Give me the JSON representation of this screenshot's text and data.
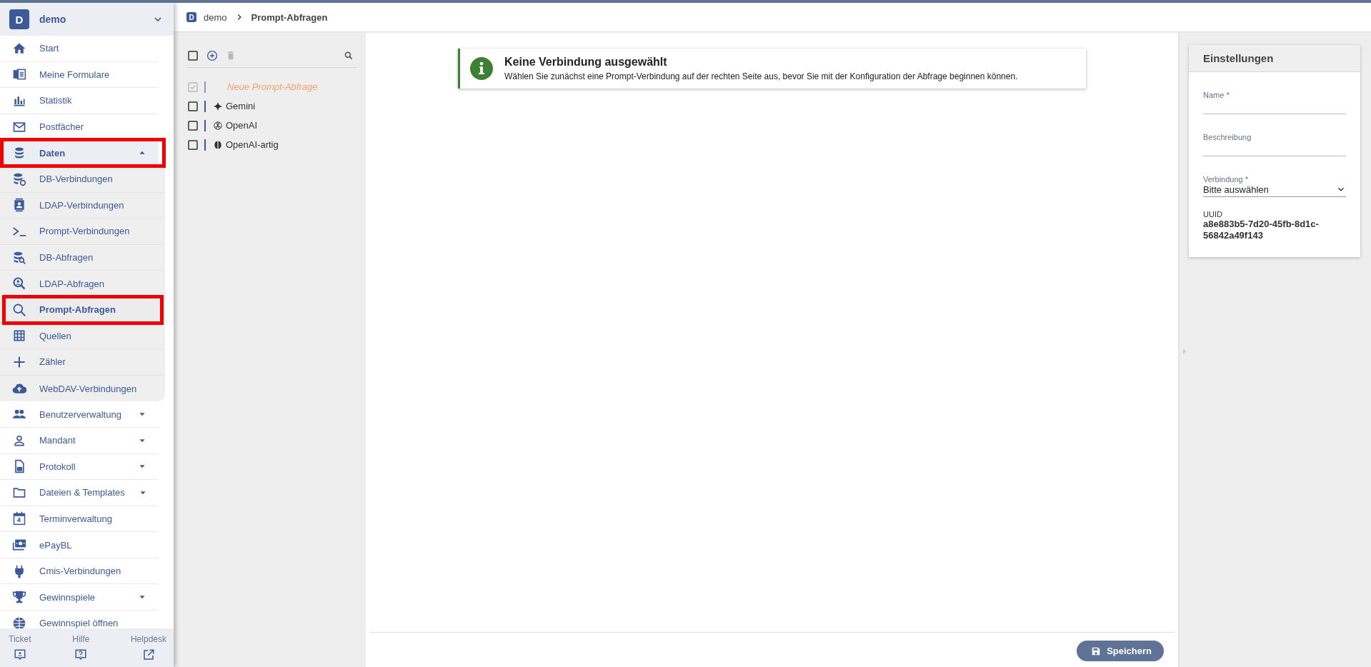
{
  "tenant": {
    "initial": "D",
    "name": "demo"
  },
  "nav": [
    {
      "label": "Start",
      "selected": false,
      "highlighted": false
    },
    {
      "label": "Meine Formulare",
      "selected": false,
      "highlighted": false
    },
    {
      "label": "Statistik",
      "selected": false,
      "highlighted": false
    },
    {
      "label": "Postfächer",
      "selected": false,
      "highlighted": false
    },
    {
      "label": "Daten",
      "selected": true,
      "highlighted": true,
      "expanded": true,
      "children": [
        {
          "label": "DB-Verbindungen",
          "selected": false,
          "highlighted": false
        },
        {
          "label": "LDAP-Verbindungen",
          "selected": false,
          "highlighted": false
        },
        {
          "label": "Prompt-Verbindungen",
          "selected": false,
          "highlighted": false
        },
        {
          "label": "DB-Abfragen",
          "selected": false,
          "highlighted": false
        },
        {
          "label": "LDAP-Abfragen",
          "selected": false,
          "highlighted": false
        },
        {
          "label": "Prompt-Abfragen",
          "selected": true,
          "highlighted": true
        },
        {
          "label": "Quellen",
          "selected": false,
          "highlighted": false
        },
        {
          "label": "Zähler",
          "selected": false,
          "highlighted": false
        },
        {
          "label": "WebDAV-Verbindungen",
          "selected": false,
          "highlighted": false
        }
      ]
    },
    {
      "label": "Benutzerverwaltung",
      "selected": false,
      "highlighted": false,
      "expanded": false
    },
    {
      "label": "Mandant",
      "selected": false,
      "highlighted": false,
      "expanded": false
    },
    {
      "label": "Protokoll",
      "selected": false,
      "highlighted": false,
      "expanded": false
    },
    {
      "label": "Dateien & Templates",
      "selected": false,
      "highlighted": false,
      "expanded": false
    },
    {
      "label": "Terminverwaltung",
      "selected": false,
      "highlighted": false
    },
    {
      "label": "ePayBL",
      "selected": false,
      "highlighted": false
    },
    {
      "label": "Cmis-Verbindungen",
      "selected": false,
      "highlighted": false
    },
    {
      "label": "Gewinnspiele",
      "selected": false,
      "highlighted": false,
      "expanded": false
    },
    {
      "label": "Gewinnspiel öffnen",
      "selected": false,
      "highlighted": false
    }
  ],
  "footer_links": [
    {
      "label": "Ticket"
    },
    {
      "label": "Hilfe"
    },
    {
      "label": "Helpdesk"
    }
  ],
  "breadcrumb": {
    "initial": "D",
    "items": [
      "demo",
      "Prompt-Abfragen"
    ]
  },
  "tree": {
    "delete_disabled": true,
    "items": [
      {
        "kind": "draft",
        "label": "Neue Prompt-Abfrage",
        "checked": true,
        "disabled": true
      },
      {
        "kind": "connection",
        "label": "Gemini",
        "checked": false,
        "disabled": false
      },
      {
        "kind": "connection",
        "label": "OpenAI",
        "checked": false,
        "disabled": false
      },
      {
        "kind": "connection",
        "label": "OpenAI-artig",
        "checked": false,
        "disabled": false
      }
    ]
  },
  "notice": {
    "title": "Keine Verbindung ausgewählt",
    "text": "Wählen Sie zunächst eine Prompt-Verbindung auf der rechten Seite aus, bevor Sie mit der Konfiguration der Abfrage beginnen können."
  },
  "save_button": {
    "label": "Speichern"
  },
  "settings": {
    "title": "Einstellungen",
    "fields": [
      {
        "kind": "text",
        "label": "Name *"
      },
      {
        "kind": "text",
        "label": "Beschreibung"
      },
      {
        "kind": "select",
        "label": "Verbindung *",
        "value": "Bitte auswählen"
      }
    ],
    "uuid": {
      "label": "UUID",
      "value": "a8e883b5-7d20-45fb-8d1c-56842a49f143"
    }
  }
}
